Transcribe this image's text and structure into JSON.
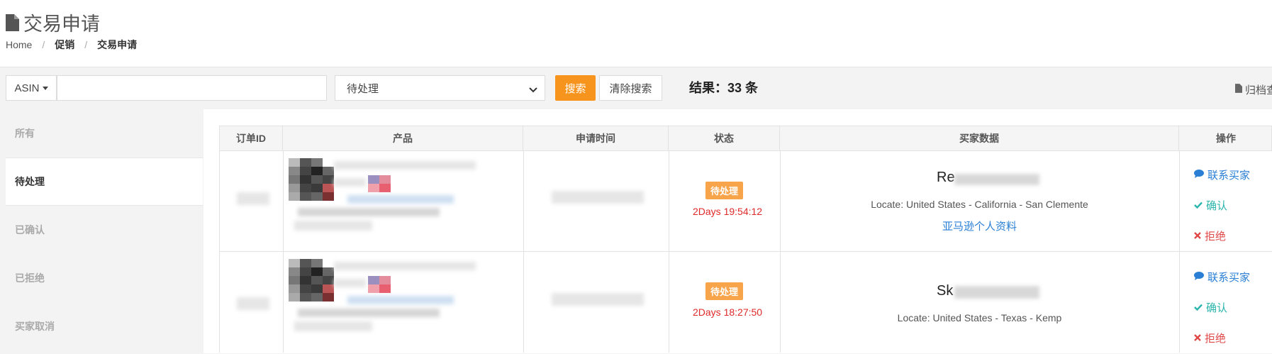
{
  "header": {
    "title": "交易申请",
    "breadcrumb": [
      "Home",
      "促销",
      "交易申请"
    ]
  },
  "toolbar": {
    "asin_label": "ASIN",
    "search_value": "",
    "status_selected": "待处理",
    "search_button": "搜索",
    "clear_button": "清除搜索",
    "result_text": "结果：33 条",
    "archive_label": "归档查"
  },
  "tabs": [
    {
      "label": "所有",
      "active": false
    },
    {
      "label": "待处理",
      "active": true
    },
    {
      "label": "已确认",
      "active": false
    },
    {
      "label": "已拒绝",
      "active": false
    },
    {
      "label": "买家取消",
      "active": false
    }
  ],
  "table": {
    "columns": [
      "订单ID",
      "产品",
      "申请时间",
      "状态",
      "买家数据",
      "操作"
    ],
    "rows": [
      {
        "status": "待处理",
        "countdown": "2Days 19:54:12",
        "buyer_prefix": "Re",
        "locate": "Locate: United States - California - San Clemente",
        "profile_link": "亚马逊个人资料",
        "actions": {
          "contact": "联系买家",
          "confirm": "确认",
          "reject": "拒绝"
        }
      },
      {
        "status": "待处理",
        "countdown": "2Days 18:27:50",
        "buyer_prefix": "Sk",
        "locate": "Locate: United States - Texas - Kemp",
        "profile_link": "",
        "actions": {
          "contact": "联系买家",
          "confirm": "确认",
          "reject": "拒绝"
        }
      }
    ]
  },
  "colors": {
    "accent": "#f7941d",
    "badge": "#f7a44a",
    "countdown": "#e02a2a",
    "link": "#2a7fd4",
    "confirm": "#2bb5ac",
    "reject": "#e04848"
  }
}
